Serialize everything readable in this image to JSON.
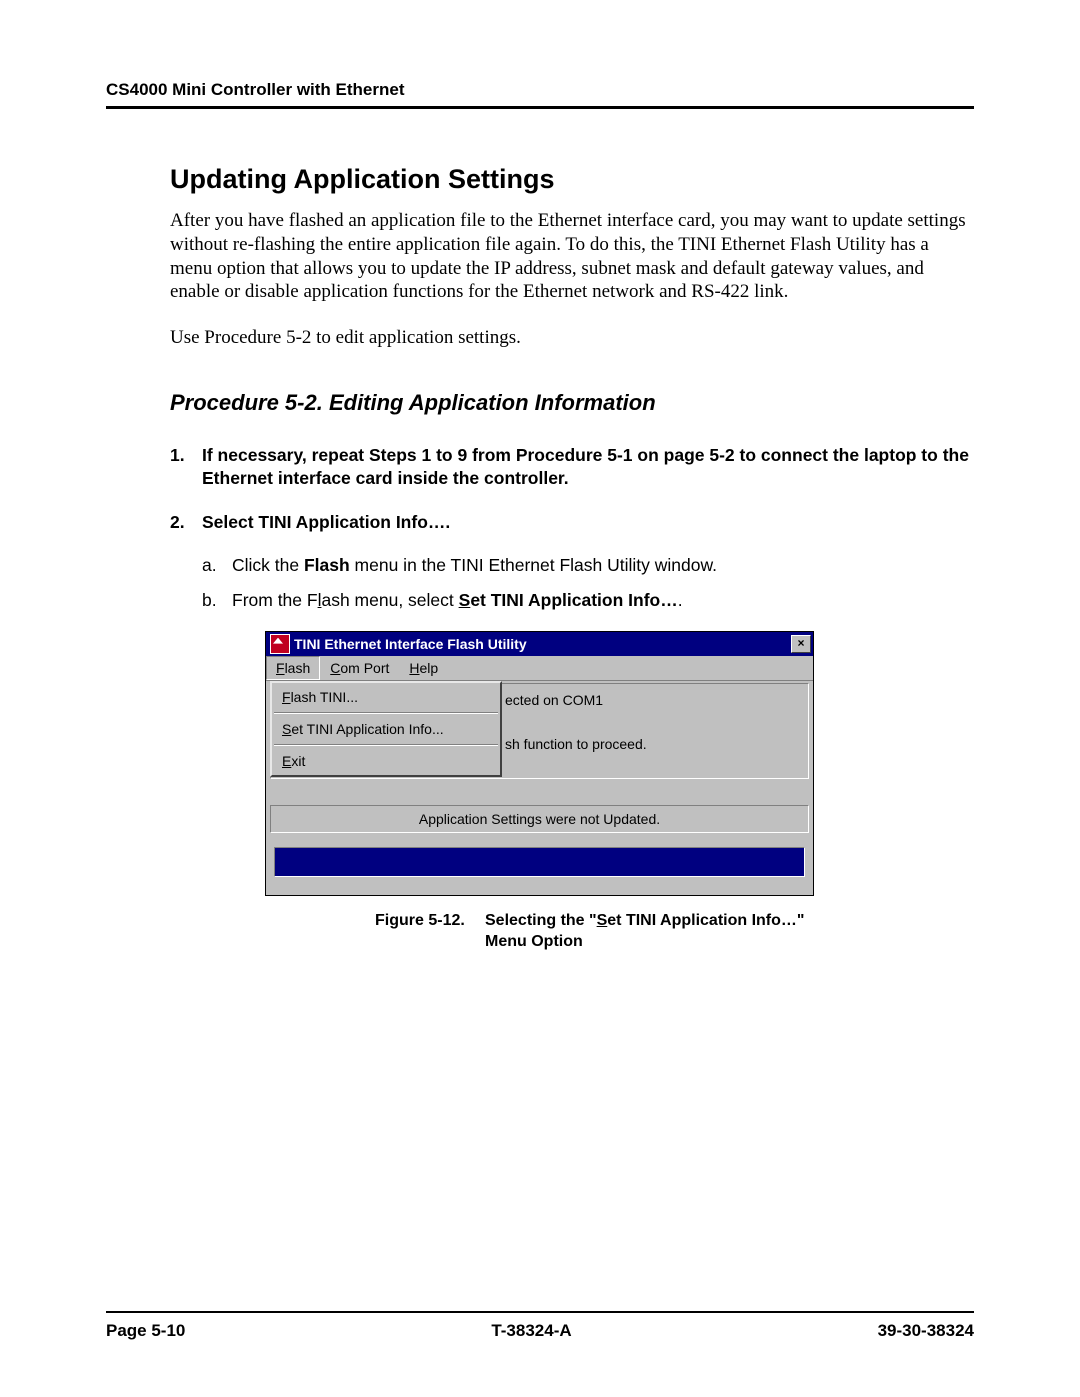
{
  "header": {
    "doc_title": "CS4000 Mini Controller with Ethernet"
  },
  "section": {
    "heading": "Updating Application Settings",
    "para1": "After you have flashed an application file to the Ethernet interface card, you may want to update settings without re-flashing the entire application file again. To do this, the TINI Ethernet Flash Utility has a menu option that allows you to update the IP address, subnet mask and default gateway values, and enable or disable application functions for the Ethernet network and RS-422 link.",
    "para2": "Use Procedure 5-2 to edit application settings.",
    "procedure_title": "Procedure 5-2. Editing Application Information",
    "steps": {
      "s1_num": "1.",
      "s1": "If necessary, repeat Steps 1 to 9 from Procedure 5-1 on page 5-2 to connect the laptop to the Ethernet interface card inside the controller.",
      "s2_num": "2.",
      "s2": "Select TINI Application Info….",
      "sa_let": "a.",
      "sa_pre": "Click the ",
      "sa_bold1": "Fl",
      "sa_bold2": "ash",
      "sa_post": " menu in the TINI Ethernet Flash Utility window.",
      "sb_let": "b.",
      "sb_pre": "From the F",
      "sb_u": "l",
      "sb_mid": "ash menu, select ",
      "sb_bold1": "S",
      "sb_bold2": "et TINI Application Info…",
      "sb_post": "."
    }
  },
  "window": {
    "title": "TINI Ethernet Interface Flash Utility",
    "menu": {
      "flash_u": "F",
      "flash_r": "lash",
      "com_u": "C",
      "com_r": "om Port",
      "help_u": "H",
      "help_r": "elp"
    },
    "dropdown": {
      "item1_u": "F",
      "item1_r": "lash TINI...",
      "item2_u": "S",
      "item2_r": "et TINI Application Info...",
      "item3_u": "E",
      "item3_r": "xit"
    },
    "panel": {
      "line1": "ected on COM1",
      "line2": "sh function to proceed."
    },
    "status": "Application Settings were not Updated.",
    "close": "×"
  },
  "figure": {
    "label": "Figure 5-12.",
    "caption_pre": "Selecting the \"",
    "caption_u": "S",
    "caption_mid": "et TINI Application Info…\" Menu Option"
  },
  "footer": {
    "left": "Page 5-10",
    "center": "T-38324-A",
    "right": "39-30-38324"
  }
}
